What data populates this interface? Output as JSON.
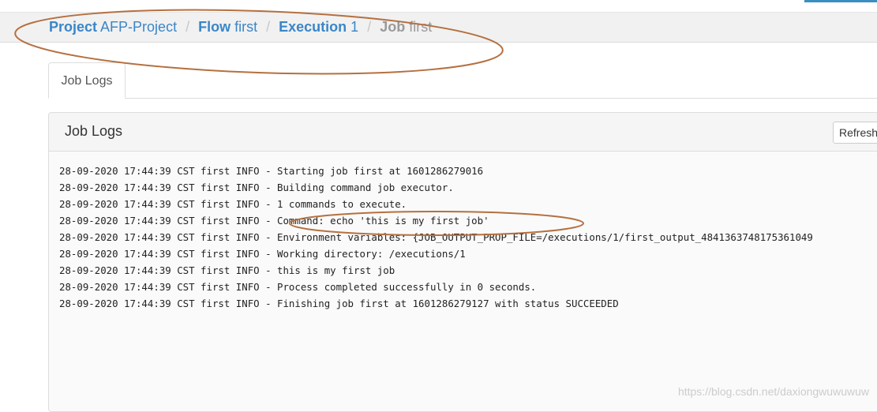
{
  "breadcrumb": {
    "project": {
      "label": "Project",
      "value": "AFP-Project"
    },
    "flow": {
      "label": "Flow",
      "value": "first"
    },
    "execution": {
      "label": "Execution",
      "value": "1"
    },
    "job": {
      "label": "Job",
      "value": "first"
    },
    "separator": "/"
  },
  "tabs": [
    {
      "label": "Job Logs"
    }
  ],
  "panel": {
    "title": "Job Logs",
    "refresh_label": "Refresh"
  },
  "log_lines": [
    "28-09-2020 17:44:39 CST first INFO - Starting job first at 1601286279016",
    "28-09-2020 17:44:39 CST first INFO - Building command job executor.",
    "28-09-2020 17:44:39 CST first INFO - 1 commands to execute.",
    "28-09-2020 17:44:39 CST first INFO - Command: echo 'this is my first job'",
    "28-09-2020 17:44:39 CST first INFO - Environment variables: {JOB_OUTPUT_PROP_FILE=/executions/1/first_output_4841363748175361049",
    "28-09-2020 17:44:39 CST first INFO - Working directory: /executions/1",
    "28-09-2020 17:44:39 CST first INFO - this is my first job",
    "28-09-2020 17:44:39 CST first INFO - Process completed successfully in 0 seconds.",
    "28-09-2020 17:44:39 CST first INFO - Finishing job first at 1601286279127 with status SUCCEEDED"
  ],
  "watermark": "https://blog.csdn.net/daxiongwuwuwuw",
  "colors": {
    "link": "#3a86c8",
    "annotation": "#b5703f"
  }
}
